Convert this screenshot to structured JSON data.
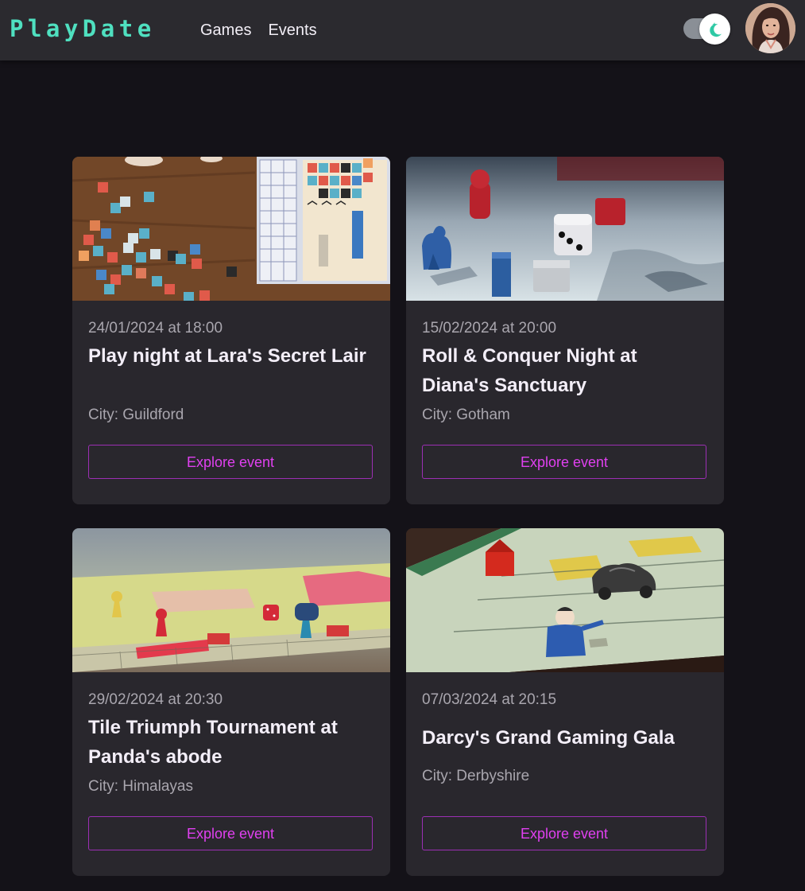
{
  "app": {
    "logo": "PlayDate"
  },
  "nav": {
    "links": [
      {
        "label": "Games"
      },
      {
        "label": "Events"
      }
    ],
    "theme_toggle_icon": "moon-stars-icon",
    "accent": "#4fe0c0"
  },
  "events": [
    {
      "date": "24/01/2024 at 18:00",
      "title": "Play night at Lara's Secret Lair",
      "city": "City: Guildford",
      "button": "Explore event",
      "image_icon": "tile-game-photo"
    },
    {
      "date": "15/02/2024 at 20:00",
      "title": "Roll & Conquer Night at Diana's Sanctuary",
      "city": "City: Gotham",
      "button": "Explore event",
      "image_icon": "dice-meeples-photo"
    },
    {
      "date": "29/02/2024 at 20:30",
      "title": "Tile Triumph Tournament at Panda's abode",
      "city": "City: Himalayas",
      "button": "Explore event",
      "image_icon": "board-pawns-photo"
    },
    {
      "date": "07/03/2024 at 20:15",
      "title": "Darcy's Grand Gaming Gala",
      "city": "City: Derbyshire",
      "button": "Explore event",
      "image_icon": "monopoly-board-photo"
    }
  ],
  "colors": {
    "background": "#141218",
    "navbar": "#2b2a2f",
    "card": "#29272d",
    "button_accent": "#e040f0"
  }
}
